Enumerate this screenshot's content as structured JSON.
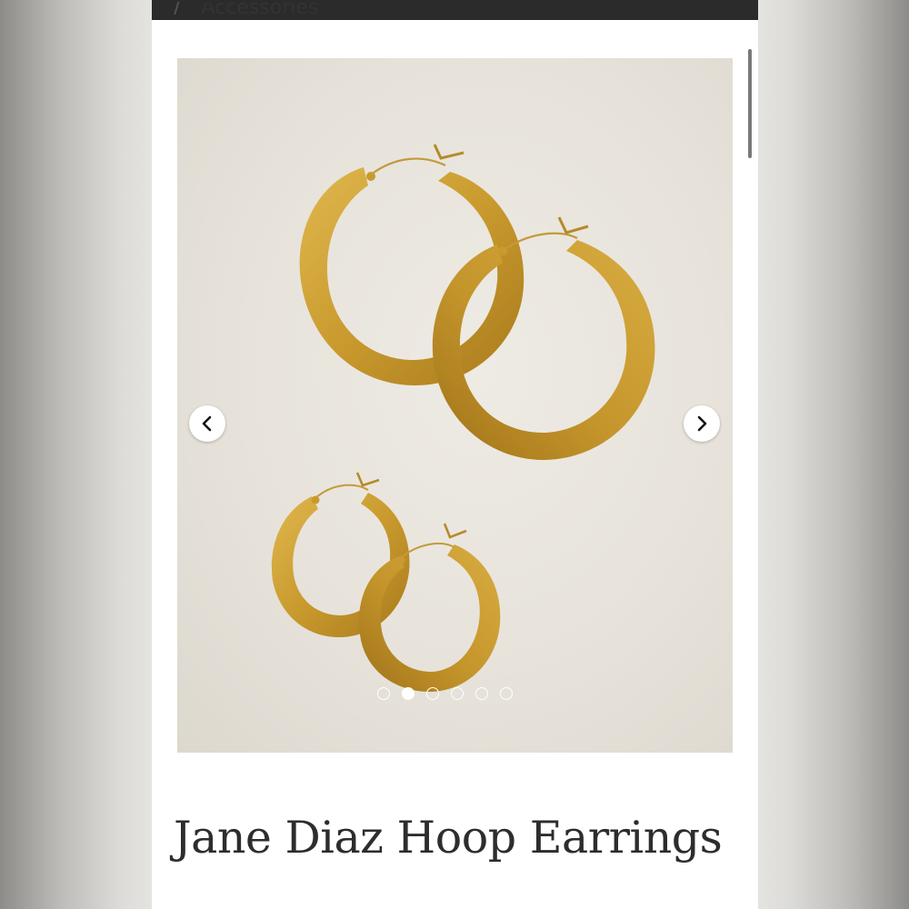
{
  "breadcrumb": {
    "separator": "/",
    "current": "Accessories"
  },
  "carousel": {
    "image_alt": "Gold hoop earrings",
    "prev_icon": "chevron-left-icon",
    "next_icon": "chevron-right-icon",
    "slide_count": 6,
    "active_slide": 2
  },
  "product": {
    "title": "Jane Diaz Hoop Earrings"
  },
  "colors": {
    "topbar": "#2b2b2b",
    "gold": "#c99a2e",
    "photo_background": "#e7e3db"
  }
}
